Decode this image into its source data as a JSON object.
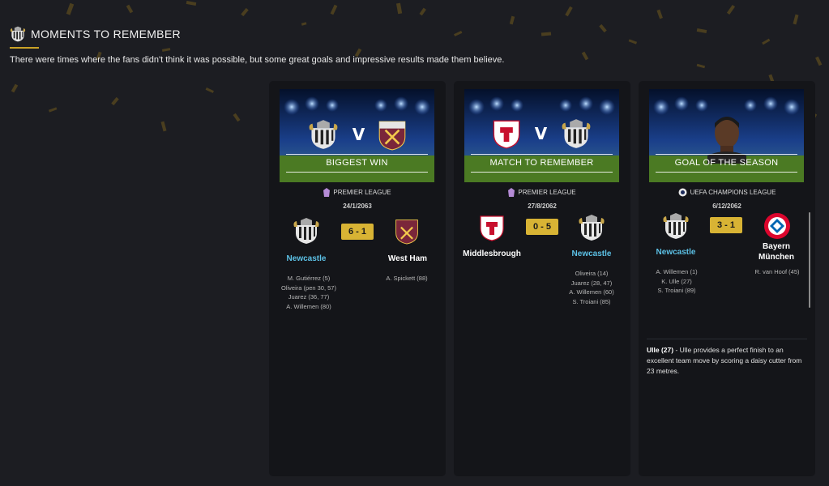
{
  "header": {
    "title": "MOMENTS TO REMEMBER",
    "subtitle": "There were times where the fans didn't think it was possible, but some great goals and impressive results made them believe."
  },
  "colors": {
    "accent_gold": "#d8b334",
    "home_team": "#5cc1e6",
    "card_bg": "#141519",
    "page_bg": "#1c1d22"
  },
  "cards": [
    {
      "caption": "BIGGEST WIN",
      "competition": "PREMIER LEAGUE",
      "date": "24/1/2063",
      "score": "6 - 1",
      "home": {
        "name": "Newcastle",
        "crest": "newcastle-crest-icon",
        "scorers": [
          "M. Gutiérrez (5)",
          "Oliveira (pen 30, 57)",
          "Juarez (36, 77)",
          "A. Willemen (80)"
        ]
      },
      "away": {
        "name": "West Ham",
        "crest": "west-ham-crest-icon",
        "scorers": [
          "A. Spickett (88)"
        ]
      },
      "vs": "V"
    },
    {
      "caption": "MATCH TO REMEMBER",
      "competition": "PREMIER LEAGUE",
      "date": "27/8/2062",
      "score": "0 - 5",
      "home": {
        "name": "Middlesbrough",
        "crest": "middlesbrough-crest-icon",
        "scorers": []
      },
      "away": {
        "name": "Newcastle",
        "crest": "newcastle-crest-icon",
        "scorers": [
          "Oliveira (14)",
          "Juarez (28, 47)",
          "A. Willemen (60)",
          "S. Troiani (85)"
        ]
      },
      "vs": "V"
    },
    {
      "caption": "GOAL OF THE SEASON",
      "competition": "UEFA CHAMPIONS LEAGUE",
      "date": "6/12/2062",
      "score": "3 - 1",
      "home": {
        "name": "Newcastle",
        "crest": "newcastle-crest-icon",
        "scorers": [
          "A. Willemen (1)",
          "K. Ulle (27)",
          "S. Troiani (89)"
        ]
      },
      "away": {
        "name": "Bayern München",
        "name_line1": "Bayern",
        "name_line2": "München",
        "crest": "bayern-crest-icon",
        "scorers": [
          "R. van Hoof (45)"
        ]
      },
      "goal_scorer": "Ulle (27)",
      "goal_description": " - Ulle provides a perfect finish to an excellent team move by scoring a daisy cutter from 23 metres."
    }
  ]
}
